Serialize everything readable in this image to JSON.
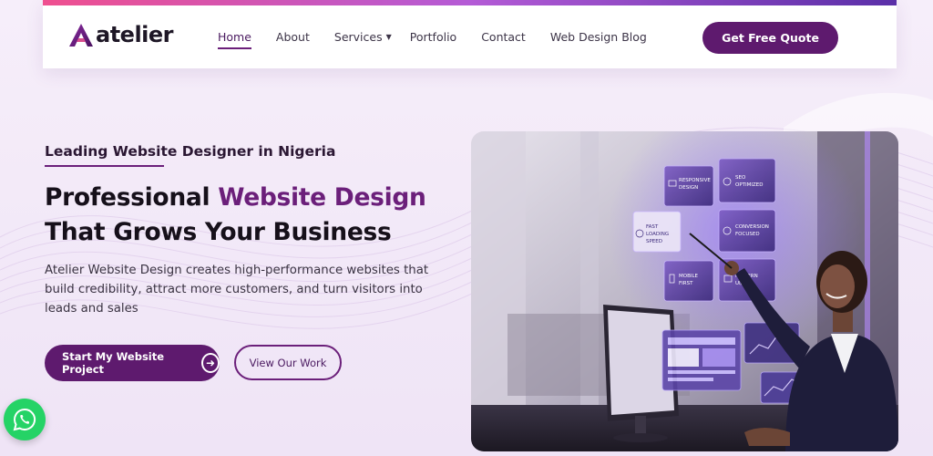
{
  "brand": {
    "name": "atelier",
    "accent": "#6b1f7a",
    "button": "#5e1a6e"
  },
  "nav": {
    "items": [
      {
        "label": "Home",
        "active": true
      },
      {
        "label": "About"
      },
      {
        "label": "Services",
        "dropdown": true
      },
      {
        "label": "Portfolio"
      },
      {
        "label": "Contact"
      },
      {
        "label": "Web Design Blog"
      }
    ],
    "cta": "Get Free Quote"
  },
  "hero": {
    "eyebrow": "Leading Website Designer in Nigeria",
    "headline": {
      "part1": "Professional ",
      "accent": "Website Design",
      "part2": " That Grows Your Business"
    },
    "description": "Atelier Website Design creates high-performance websites that build credibility, attract more customers, and turn visitors into leads and sales",
    "primary_button": "Start My Website Project",
    "secondary_button": "View Our Work"
  },
  "hero_image": {
    "panels": [
      {
        "line1": "RESPONSIVE",
        "line2": "DESIGN"
      },
      {
        "line1": "SEO",
        "line2": "OPTIMIZED"
      },
      {
        "line1": "FAST",
        "line2": "LOADING",
        "line3": "SPEED"
      },
      {
        "line1": "CONVERSION",
        "line2": "FOCUSED"
      },
      {
        "line1": "MOBILE",
        "line2": "FIRST"
      },
      {
        "line1": "MODERN",
        "line2": "UI/UX"
      }
    ]
  },
  "whatsapp": {
    "icon": "whatsapp-icon",
    "color": "#25d366"
  }
}
